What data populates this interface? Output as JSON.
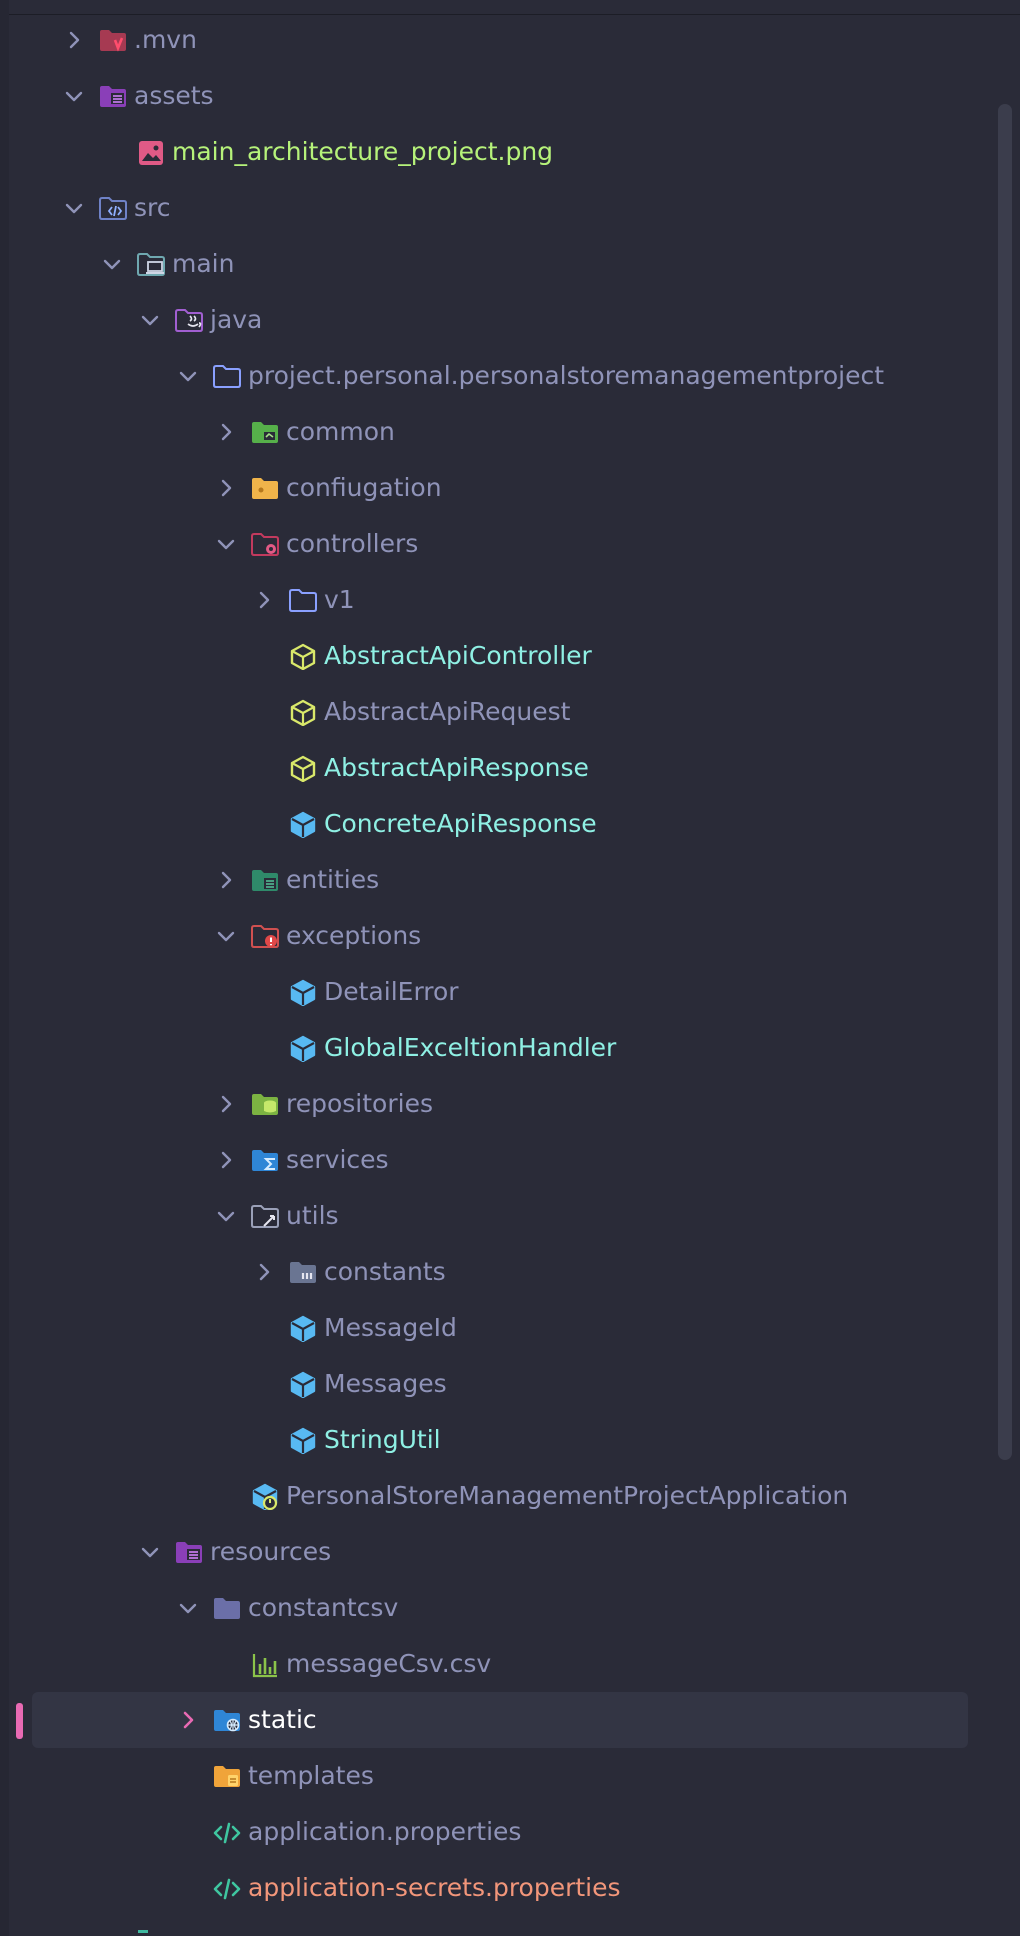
{
  "tree": {
    "rows": [
      {
        "id": "mvn",
        "label": ".mvn",
        "depth": 0,
        "chevron": "right",
        "icon": "maven-folder-icon",
        "color": "#8f93b8"
      },
      {
        "id": "assets",
        "label": "assets",
        "depth": 0,
        "chevron": "down",
        "icon": "resources-folder-icon",
        "color": "#8f93b8"
      },
      {
        "id": "main-architecture-png",
        "label": "main_architecture_project.png",
        "depth": 1,
        "chevron": "none",
        "icon": "image-file-icon",
        "color": "#b6f27a"
      },
      {
        "id": "src",
        "label": "src",
        "depth": 0,
        "chevron": "down",
        "icon": "source-folder-icon",
        "color": "#8f93b8"
      },
      {
        "id": "main",
        "label": "main",
        "depth": 1,
        "chevron": "down",
        "icon": "module-folder-icon",
        "color": "#8f93b8"
      },
      {
        "id": "java",
        "label": "java",
        "depth": 2,
        "chevron": "down",
        "icon": "java-folder-icon",
        "color": "#8f93b8"
      },
      {
        "id": "package",
        "label": "project.personal.personalstoremanagementproject",
        "depth": 3,
        "chevron": "down",
        "icon": "package-folder-icon",
        "color": "#8f93b8"
      },
      {
        "id": "common",
        "label": "common",
        "depth": 4,
        "chevron": "right",
        "icon": "common-folder-icon",
        "color": "#8f93b8"
      },
      {
        "id": "confiugation",
        "label": "confiugation",
        "depth": 4,
        "chevron": "right",
        "icon": "config-folder-icon",
        "color": "#8f93b8"
      },
      {
        "id": "controllers",
        "label": "controllers",
        "depth": 4,
        "chevron": "down",
        "icon": "controllers-folder-icon",
        "color": "#8f93b8"
      },
      {
        "id": "v1",
        "label": "v1",
        "depth": 5,
        "chevron": "right",
        "icon": "folder-outline-icon",
        "color": "#8f93b8"
      },
      {
        "id": "abstract-api-controller",
        "label": "AbstractApiController",
        "depth": 5,
        "chevron": "none",
        "icon": "abstract-class-icon",
        "color": "#8ff0e4"
      },
      {
        "id": "abstract-api-request",
        "label": "AbstractApiRequest",
        "depth": 5,
        "chevron": "none",
        "icon": "abstract-class-icon",
        "color": "#8f93b8"
      },
      {
        "id": "abstract-api-response",
        "label": "AbstractApiResponse",
        "depth": 5,
        "chevron": "none",
        "icon": "abstract-class-icon",
        "color": "#8ff0e4"
      },
      {
        "id": "concrete-api-response",
        "label": "ConcreteApiResponse",
        "depth": 5,
        "chevron": "none",
        "icon": "class-icon",
        "color": "#8ff0e4"
      },
      {
        "id": "entities",
        "label": "entities",
        "depth": 4,
        "chevron": "right",
        "icon": "entities-folder-icon",
        "color": "#8f93b8"
      },
      {
        "id": "exceptions",
        "label": "exceptions",
        "depth": 4,
        "chevron": "down",
        "icon": "exceptions-folder-icon",
        "color": "#8f93b8"
      },
      {
        "id": "detail-error",
        "label": "DetailError",
        "depth": 5,
        "chevron": "none",
        "icon": "class-icon",
        "color": "#8f93b8"
      },
      {
        "id": "global-exception-handler",
        "label": "GlobalExceltionHandler",
        "depth": 5,
        "chevron": "none",
        "icon": "class-icon",
        "color": "#8ff0e4"
      },
      {
        "id": "repositories",
        "label": "repositories",
        "depth": 4,
        "chevron": "right",
        "icon": "repositories-folder-icon",
        "color": "#8f93b8"
      },
      {
        "id": "services",
        "label": "services",
        "depth": 4,
        "chevron": "right",
        "icon": "services-folder-icon",
        "color": "#8f93b8"
      },
      {
        "id": "utils",
        "label": "utils",
        "depth": 4,
        "chevron": "down",
        "icon": "utils-folder-icon",
        "color": "#8f93b8"
      },
      {
        "id": "constants",
        "label": "constants",
        "depth": 5,
        "chevron": "right",
        "icon": "constants-folder-icon",
        "color": "#8f93b8"
      },
      {
        "id": "message-id",
        "label": "MessageId",
        "depth": 5,
        "chevron": "none",
        "icon": "class-icon",
        "color": "#8f93b8"
      },
      {
        "id": "messages",
        "label": "Messages",
        "depth": 5,
        "chevron": "none",
        "icon": "class-icon",
        "color": "#8f93b8"
      },
      {
        "id": "string-util",
        "label": "StringUtil",
        "depth": 5,
        "chevron": "none",
        "icon": "class-icon",
        "color": "#8ff0e4"
      },
      {
        "id": "application-class",
        "label": "PersonalStoreManagementProjectApplication",
        "depth": 4,
        "chevron": "none",
        "icon": "spring-app-class-icon",
        "color": "#8f93b8"
      },
      {
        "id": "resources",
        "label": "resources",
        "depth": 2,
        "chevron": "down",
        "icon": "resources-folder-icon",
        "color": "#8f93b8"
      },
      {
        "id": "constantcsv",
        "label": "constantcsv",
        "depth": 3,
        "chevron": "down",
        "icon": "folder-filled-icon",
        "color": "#8f93b8"
      },
      {
        "id": "message-csv",
        "label": "messageCsv.csv",
        "depth": 4,
        "chevron": "none",
        "icon": "csv-file-icon",
        "color": "#8f93b8"
      },
      {
        "id": "static",
        "label": "static",
        "depth": 3,
        "chevron": "right",
        "icon": "web-folder-icon",
        "color": "#ffffff",
        "selected": true
      },
      {
        "id": "templates",
        "label": "templates",
        "depth": 3,
        "chevron": "none",
        "icon": "templates-folder-icon",
        "color": "#8f93b8"
      },
      {
        "id": "application-properties",
        "label": "application.properties",
        "depth": 3,
        "chevron": "none",
        "icon": "properties-file-icon",
        "color": "#8f93b8"
      },
      {
        "id": "application-secrets-properties",
        "label": "application-secrets.properties",
        "depth": 3,
        "chevron": "none",
        "icon": "properties-file-icon",
        "color": "#f2967a"
      }
    ]
  }
}
